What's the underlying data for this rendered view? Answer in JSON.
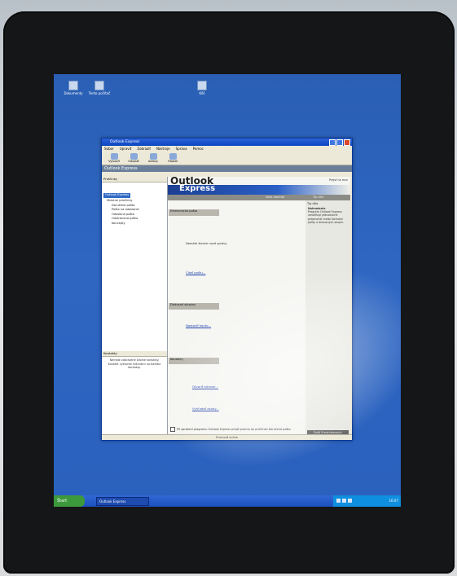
{
  "desktop": {
    "icons": [
      {
        "label": "Dokumenty",
        "icon": "folder-icon"
      },
      {
        "label": "Tento počítač",
        "icon": "computer-icon"
      },
      {
        "label": "Kôš",
        "icon": "recycle-bin-icon"
      }
    ]
  },
  "window": {
    "title": "Outlook Express",
    "menu": [
      "Súbor",
      "Upraviť",
      "Zobraziť",
      "Nástroje",
      "Správa",
      "Pomoc"
    ],
    "toolbar": [
      {
        "label": "Vytvoriť",
        "icon": "new-mail-icon"
      },
      {
        "label": "Odoslať",
        "icon": "send-receive-icon"
      },
      {
        "label": "Adresy",
        "icon": "addresses-icon"
      },
      {
        "label": "Hľadať",
        "icon": "find-icon"
      }
    ],
    "banner": "Outlook Express",
    "folders": {
      "title": "Priečinky",
      "items": [
        {
          "label": "Outlook Express",
          "selected": true
        },
        {
          "label": "Miestne priečinky",
          "selected": false
        },
        {
          "label": "Doručená pošta",
          "selected": false
        },
        {
          "label": "Pošta na odoslanie",
          "selected": false
        },
        {
          "label": "Odoslaná pošta",
          "selected": false
        },
        {
          "label": "Odstránená pošta",
          "selected": false
        },
        {
          "label": "Koncepty",
          "selected": false
        }
      ]
    },
    "contacts": {
      "title": "Kontakty",
      "text": "Nemáte zobrazené žiadne kontakty. Kontakt vytvoríte kliknutím na tlačidlo Kontakty."
    },
    "main": {
      "logo_line1": "Outlook",
      "logo_line2": "Express",
      "top_right": "Prejsť na msn",
      "subbar_left": "Vaša identita",
      "subbar_right": "Tip dňa",
      "sections": [
        {
          "title": "Elektronická pošta",
          "text": "Nemáte žiadne nové správy.",
          "link": "Čítať poštu..."
        },
        {
          "title": "Diskusné skupiny",
          "link": "Nastaviť konto..."
        },
        {
          "title": "Kontakty",
          "links": [
            "Otvoriť adresár...",
            "Vyhľadať osoby..."
          ]
        }
      ],
      "checkbox_label": "Pri spustení programu Outlook Express prejsť priamo do priečinka Doručená pošta.",
      "tip": {
        "title": "Tip dňa",
        "subtitle": "Nahradenie",
        "text": "Program Outlook Express umožňuje jednoduché prepínanie medzi kontami pošty a diskusných skupín."
      },
      "tip_nav": "Ďalší  Predchádzajúci"
    },
    "status": "Pracovať online"
  },
  "taskbar": {
    "start_label": "Štart",
    "task_label": "Outlook Express",
    "clock": "16:07"
  },
  "colors": {
    "desktop": "#2e66c2",
    "titlebar": "#0b45c2",
    "window_bg": "#ece9d8",
    "taskbar": "#1c4fbf",
    "start": "#3c9a3c"
  }
}
